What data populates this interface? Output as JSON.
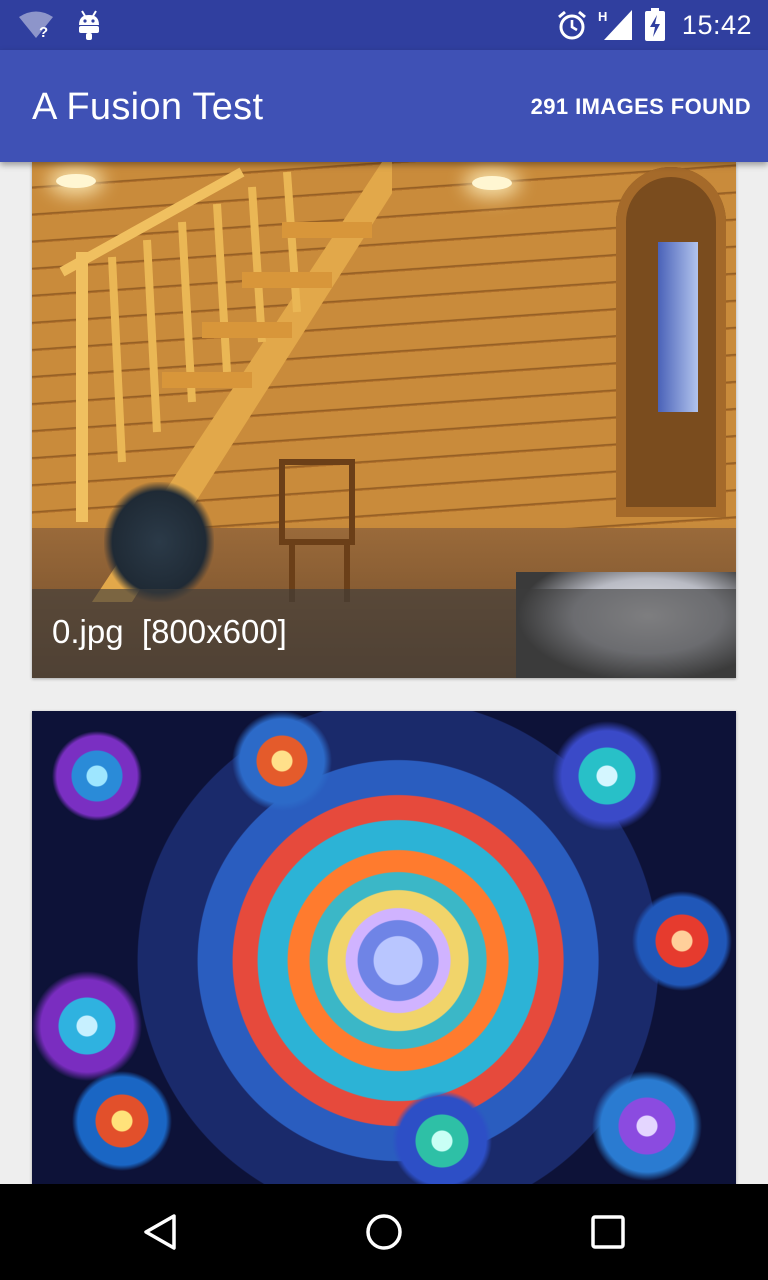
{
  "status_bar": {
    "time": "15:42",
    "network_type": "H",
    "icons": [
      "wifi-unknown-icon",
      "android-debug-icon",
      "alarm-icon",
      "signal-icon",
      "battery-charging-icon"
    ]
  },
  "app_bar": {
    "title": "A Fusion Test",
    "images_found": "291 IMAGES FOUND"
  },
  "images": [
    {
      "caption": "0.jpg  [800x600]",
      "content": "wooden-room-photo"
    },
    {
      "caption": "",
      "content": "colorful-fractal-image"
    }
  ],
  "nav_bar": {
    "buttons": [
      "back-icon",
      "home-icon",
      "recents-icon"
    ]
  },
  "colors": {
    "status_bar": "#303F9F",
    "app_bar": "#3F51B5",
    "background": "#EEEEEE",
    "nav_bar": "#000000"
  }
}
